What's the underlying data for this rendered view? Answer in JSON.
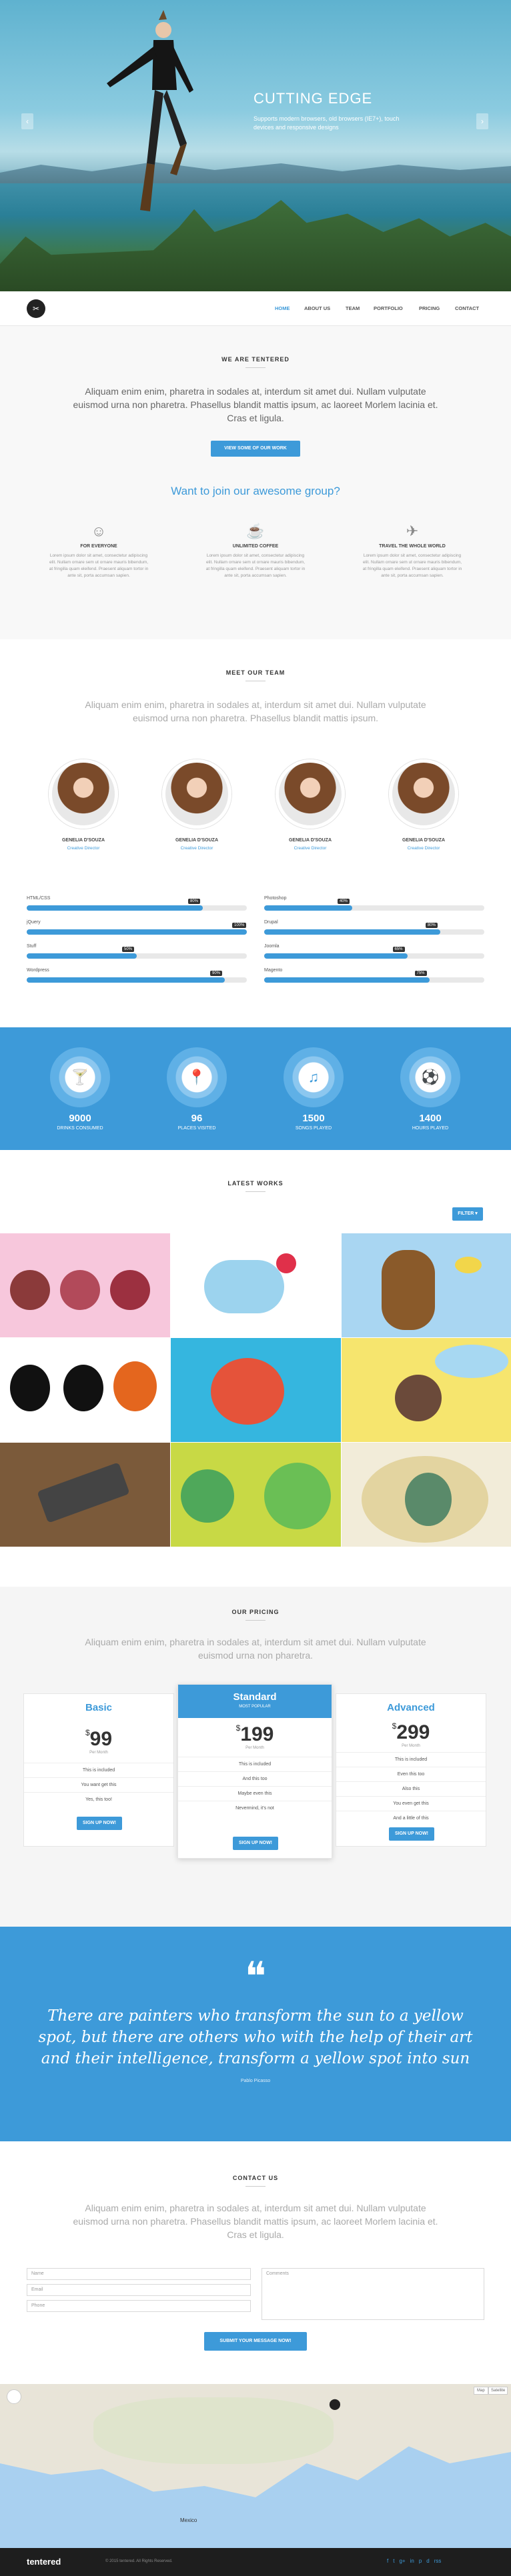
{
  "hero": {
    "title": "CUTTING EDGE",
    "subtitle": "Supports modern browsers, old browsers (IE7+), touch devices and responsive designs",
    "prev": "‹",
    "next": "›"
  },
  "nav": {
    "logo": "✂",
    "links": [
      "HOME",
      "ABOUT US",
      "TEAM",
      "PORTFOLIO",
      "PRICING",
      "CONTACT"
    ]
  },
  "about": {
    "title": "WE ARE TENTERED",
    "lead": "Aliquam enim enim, pharetra in sodales at, interdum sit amet dui. Nullam vulputate euismod urna non pharetra. Phasellus blandit mattis ipsum, ac laoreet Morlem lacinia et. Cras et ligula.",
    "button": "VIEW SOME OF OUR WORK",
    "join": "Want to join our awesome group?",
    "features": [
      {
        "icon": "☺",
        "title": "FOR EVERYONE",
        "text": "Lorem ipsum dolor sit amet, consectetur adipiscing elit. Nullam ornare sem ut ornare mauris bibendum, at fringilla quam eleifend. Praesent aliquam tortor in ante sit, porta accumsan sapien."
      },
      {
        "icon": "☕",
        "title": "UNLIMITED COFFEE",
        "text": "Lorem ipsum dolor sit amet, consectetur adipiscing elit. Nullam ornare sem ut ornare mauris bibendum, at fringilla quam eleifend. Praesent aliquam tortor in ante sit, porta accumsan sapien."
      },
      {
        "icon": "✈",
        "title": "TRAVEL THE WHOLE WORLD",
        "text": "Lorem ipsum dolor sit amet, consectetur adipiscing elit. Nullam ornare sem ut ornare mauris bibendum, at fringilla quam eleifend. Praesent aliquam tortor in ante sit, porta accumsan sapien."
      }
    ]
  },
  "team": {
    "title": "MEET OUR TEAM",
    "lead": "Aliquam enim enim, pharetra in sodales at, interdum sit amet dui. Nullam vulputate euismod urna non pharetra. Phasellus blandit mattis ipsum.",
    "members": [
      {
        "name": "GENELIA D'SOUZA",
        "role": "Creative Director"
      },
      {
        "name": "GENELIA D'SOUZA",
        "role": "Creative Director"
      },
      {
        "name": "GENELIA D'SOUZA",
        "role": "Creative Director"
      },
      {
        "name": "GENELIA D'SOUZA",
        "role": "Creative Director"
      }
    ],
    "skills_left": [
      {
        "name": "HTML/CSS",
        "value": 80,
        "label": "80%"
      },
      {
        "name": "jQuery",
        "value": 100,
        "label": "100%"
      },
      {
        "name": "Stuff",
        "value": 50,
        "label": "50%"
      },
      {
        "name": "Wordpress",
        "value": 90,
        "label": "90%"
      }
    ],
    "skills_right": [
      {
        "name": "Photoshop",
        "value": 40,
        "label": "40%"
      },
      {
        "name": "Drupal",
        "value": 80,
        "label": "80%"
      },
      {
        "name": "Joomla",
        "value": 65,
        "label": "65%"
      },
      {
        "name": "Magento",
        "value": 75,
        "label": "75%"
      }
    ]
  },
  "stats": [
    {
      "icon": "🍸",
      "number": "9000",
      "caption": "DRINKS CONSUMED"
    },
    {
      "icon": "📍",
      "number": "96",
      "caption": "PLACES VISITED"
    },
    {
      "icon": "♫",
      "number": "1500",
      "caption": "SONGS PLAYED"
    },
    {
      "icon": "⚽",
      "number": "1400",
      "caption": "HOURS PLAYED"
    }
  ],
  "works": {
    "title": "LATEST WORKS",
    "filter": "FILTER ▾",
    "tiles": [
      {
        "bg": "#f7c7dc"
      },
      {
        "bg": "#ffffff"
      },
      {
        "bg": "#a9d6f2"
      },
      {
        "bg": "#ffffff"
      },
      {
        "bg": "#35b6df"
      },
      {
        "bg": "#f6e56e"
      },
      {
        "bg": "#7b5a3a"
      },
      {
        "bg": "#c8d945"
      },
      {
        "bg": "#f2ecd9"
      }
    ]
  },
  "pricing": {
    "title": "OUR PRICING",
    "lead": "Aliquam enim enim, pharetra in sodales at, interdum sit amet dui. Nullam vulputate euismod urna non pharetra.",
    "plans": [
      {
        "name": "Basic",
        "badge": "",
        "price": "99",
        "per": "Per Month",
        "rows": [
          "This is included",
          "You want get this",
          "Yes, this too!"
        ],
        "button": "SIGN UP NOW!"
      },
      {
        "name": "Standard",
        "badge": "MOST POPULAR",
        "price": "199",
        "per": "Per Month",
        "rows": [
          "This is included",
          "And this too",
          "Maybe even this",
          "Nevermind, it's not"
        ],
        "button": "SIGN UP NOW!"
      },
      {
        "name": "Advanced",
        "badge": "",
        "price": "299",
        "per": "Per Month",
        "rows": [
          "This is included",
          "Even this too",
          "Also this",
          "You even get this",
          "And a little of this"
        ],
        "button": "SIGN UP NOW!"
      }
    ],
    "currency": "$"
  },
  "quote": {
    "mark": "❝",
    "text": "There are painters who transform the sun to a yellow spot, but there are others who with the help of their art and their intelligence, transform a yellow spot into sun",
    "author": "Pablo Picasso"
  },
  "contact": {
    "title": "CONTACT US",
    "lead": "Aliquam enim enim, pharetra in sodales at, interdum sit amet dui. Nullam vulputate euismod urna non pharetra. Phasellus blandit mattis ipsum, ac laoreet Morlem lacinia et. Cras et ligula.",
    "name_placeholder": "Name",
    "email_placeholder": "Email",
    "phone_placeholder": "Phone",
    "comment_placeholder": "Comments",
    "submit": "SUBMIT YOUR MESSAGE NOW!"
  },
  "map": {
    "labels": {
      "mexico": "Mexico",
      "map_btn": "Map",
      "sat_btn": "Satellite"
    },
    "marker": "⬤"
  },
  "footer": {
    "logo": "tentered",
    "copyright": "© 2015 tentered. All Rights Reserved.",
    "social": [
      "f",
      "t",
      "g+",
      "in",
      "p",
      "d",
      "rss"
    ]
  },
  "colors": {
    "accent": "#3d9ad9",
    "footer": "#1e1e1e"
  }
}
